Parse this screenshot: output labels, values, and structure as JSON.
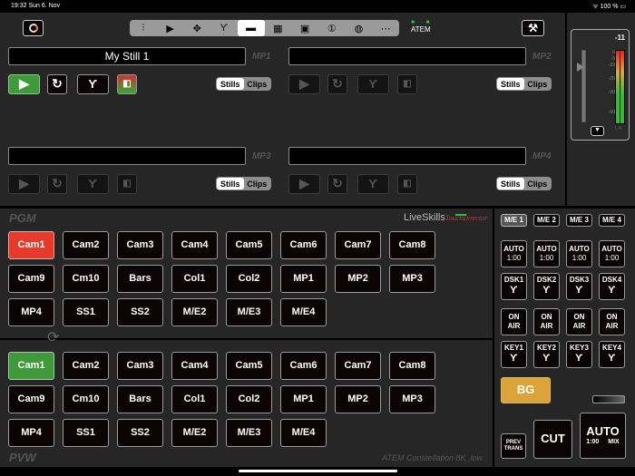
{
  "status_bar": {
    "time": "19:32",
    "date": "Sun 6. Nov",
    "battery": "100 %"
  },
  "toolbar": {
    "icons": [
      "mixer-icon",
      "play-icon",
      "move-icon",
      "transition-icon",
      "media-player-icon",
      "multiview-icon",
      "supersource-icon",
      "macro-icon",
      "audio-icon",
      "more-icon"
    ],
    "active_index": 4,
    "device_label": "ATEM"
  },
  "media_players": [
    {
      "label": "MP1",
      "clip_name": "My Still 1",
      "active": true,
      "toggle": [
        "Stills",
        "Clips"
      ]
    },
    {
      "label": "MP2",
      "clip_name": "",
      "active": false,
      "toggle": [
        "Stills",
        "Clips"
      ]
    },
    {
      "label": "MP3",
      "clip_name": "",
      "active": false,
      "toggle": [
        "Stills",
        "Clips"
      ]
    },
    {
      "label": "MP4",
      "clip_name": "",
      "active": false,
      "toggle": [
        "Stills",
        "Clips"
      ]
    }
  ],
  "audio_meter": {
    "level": "-11",
    "scale": [
      "0",
      "-5",
      "-10",
      "-20",
      "-30",
      "-50"
    ],
    "channels": "L R"
  },
  "pgm": {
    "label": "PGM",
    "selected": "Cam1",
    "selected_color": "#e8392b"
  },
  "pvw": {
    "label": "PVW",
    "selected": "Cam1",
    "selected_color": "#3f9a3a"
  },
  "sources": [
    "Cam1",
    "Cam2",
    "Cam3",
    "Cam4",
    "Cam5",
    "Cam6",
    "Cam7",
    "Cam8",
    "Cam9",
    "Cm10",
    "Bars",
    "Col1",
    "Col2",
    "MP1",
    "MP2",
    "MP3",
    "MP4",
    "SS1",
    "SS2",
    "M/E2",
    "M/E3",
    "M/E4"
  ],
  "brand": {
    "name": "LiveSkills",
    "sub": "TouchDirector"
  },
  "device_name": "ATEM Constellation 8K_low",
  "me_tabs": [
    "M/E 1",
    "M/E 2",
    "M/E 3",
    "M/E 4"
  ],
  "keyers": {
    "auto": [
      {
        "l1": "AUTO",
        "l2": "1:00"
      },
      {
        "l1": "AUTO",
        "l2": "1:00"
      },
      {
        "l1": "AUTO",
        "l2": "1:00"
      },
      {
        "l1": "AUTO",
        "l2": "1:00"
      }
    ],
    "dsk": [
      "DSK1",
      "DSK2",
      "DSK3",
      "DSK4"
    ],
    "on_air": [
      {
        "l1": "ON",
        "l2": "AIR"
      },
      {
        "l1": "ON",
        "l2": "AIR"
      },
      {
        "l1": "ON",
        "l2": "AIR"
      },
      {
        "l1": "ON",
        "l2": "AIR"
      }
    ],
    "key": [
      "KEY1",
      "KEY2",
      "KEY3",
      "KEY4"
    ]
  },
  "transition": {
    "bg": "BG",
    "bg_color": "#dca339",
    "prev_trans": [
      "PREV",
      "TRANS"
    ],
    "cut": "CUT",
    "auto": "AUTO",
    "auto_rate": "1:00",
    "auto_type": "MIX",
    "tbar_position": 0
  }
}
